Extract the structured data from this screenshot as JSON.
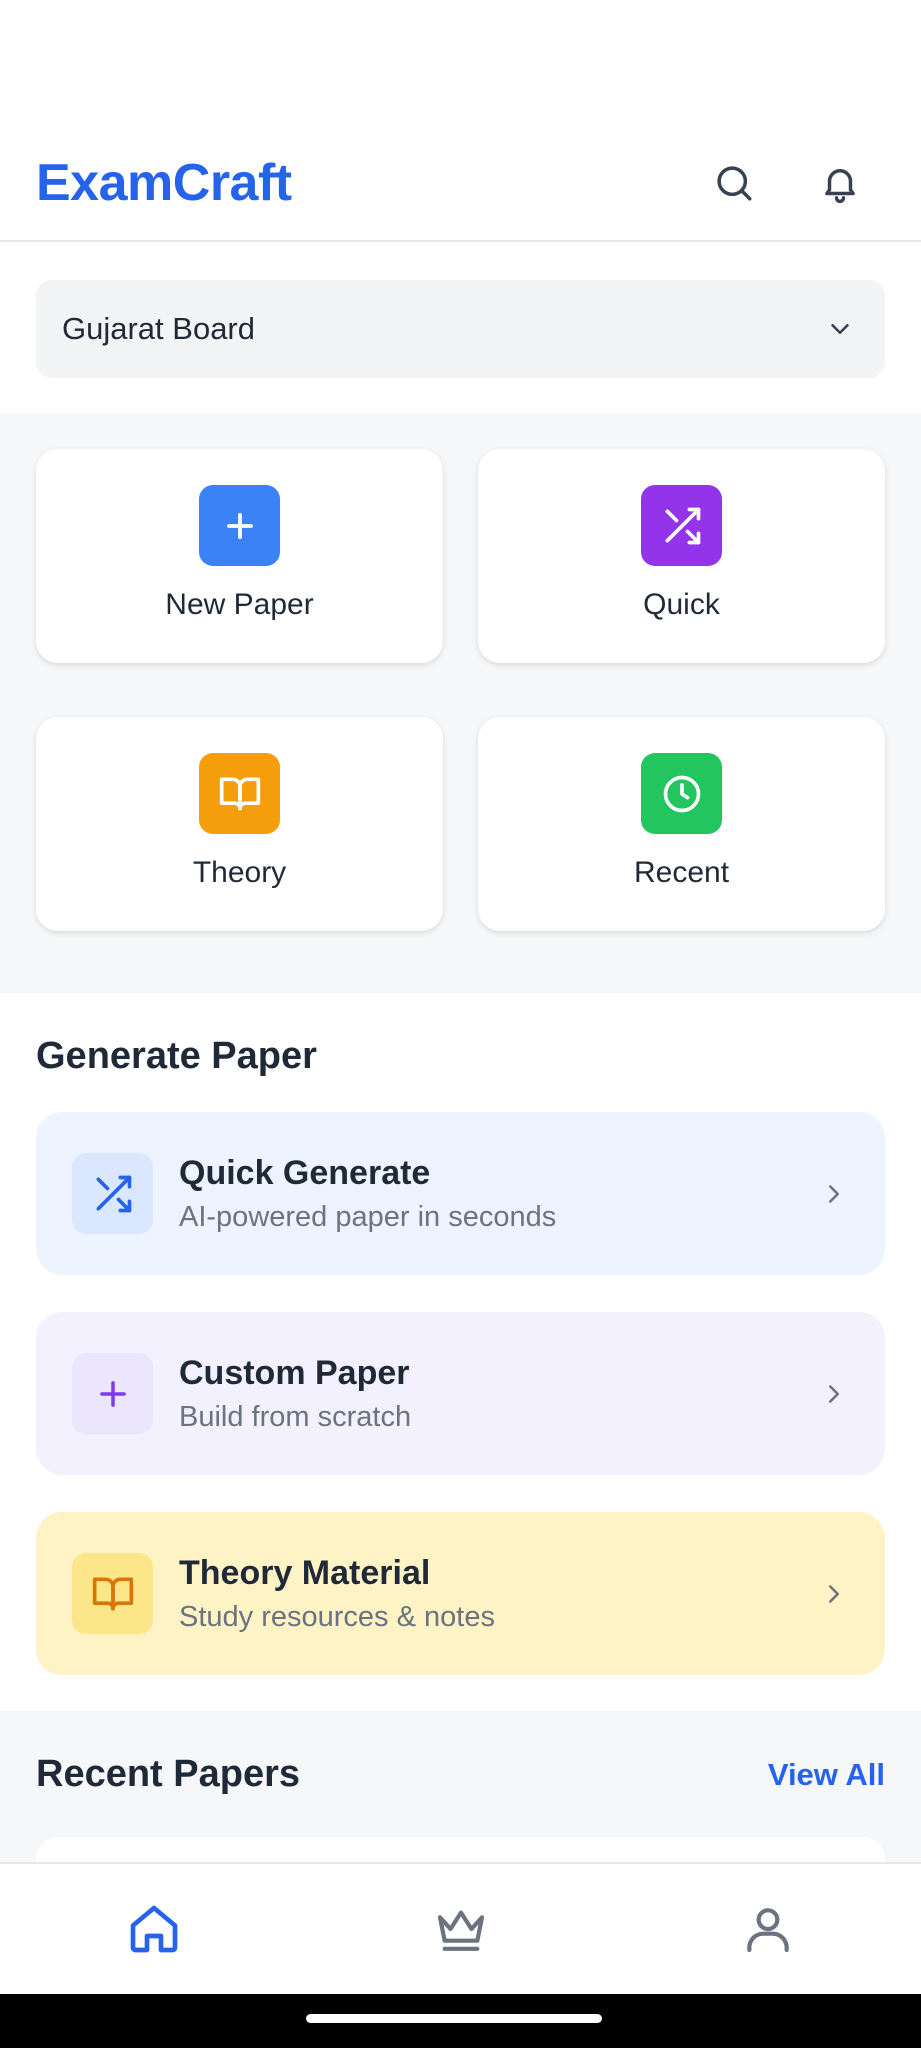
{
  "app": {
    "title": "ExamCraft"
  },
  "header": {
    "search_icon": "search-icon",
    "bell_icon": "bell-icon"
  },
  "board": {
    "selected": "Gujarat Board"
  },
  "quick_actions": [
    {
      "label": "New Paper",
      "icon": "plus-icon",
      "color": "#3b82f6"
    },
    {
      "label": "Quick",
      "icon": "shuffle-icon",
      "color": "#9333ea"
    },
    {
      "label": "Theory",
      "icon": "book-icon",
      "color": "#f59e0b"
    },
    {
      "label": "Recent",
      "icon": "clock-icon",
      "color": "#22c55e"
    }
  ],
  "generate": {
    "title": "Generate Paper",
    "cards": [
      {
        "title": "Quick Generate",
        "subtitle": "AI-powered paper in seconds",
        "icon": "shuffle-icon",
        "bg": "#eef4ff",
        "icon_bg": "#dbe7fe",
        "icon_color": "#2563eb"
      },
      {
        "title": "Custom Paper",
        "subtitle": "Build from scratch",
        "icon": "plus-icon",
        "bg": "#f3f1fe",
        "icon_bg": "#ebe5fd",
        "icon_color": "#7c3aed"
      },
      {
        "title": "Theory Material",
        "subtitle": "Study resources & notes",
        "icon": "book-icon",
        "bg": "#fdf3c4",
        "icon_bg": "#fce68a",
        "icon_color": "#d97706"
      }
    ]
  },
  "recent": {
    "title": "Recent Papers",
    "view_all": "View All"
  },
  "nav": {
    "items": [
      "home-icon",
      "crown-icon",
      "user-icon"
    ],
    "active_color": "#2563eb",
    "inactive_color": "#6b7280"
  }
}
